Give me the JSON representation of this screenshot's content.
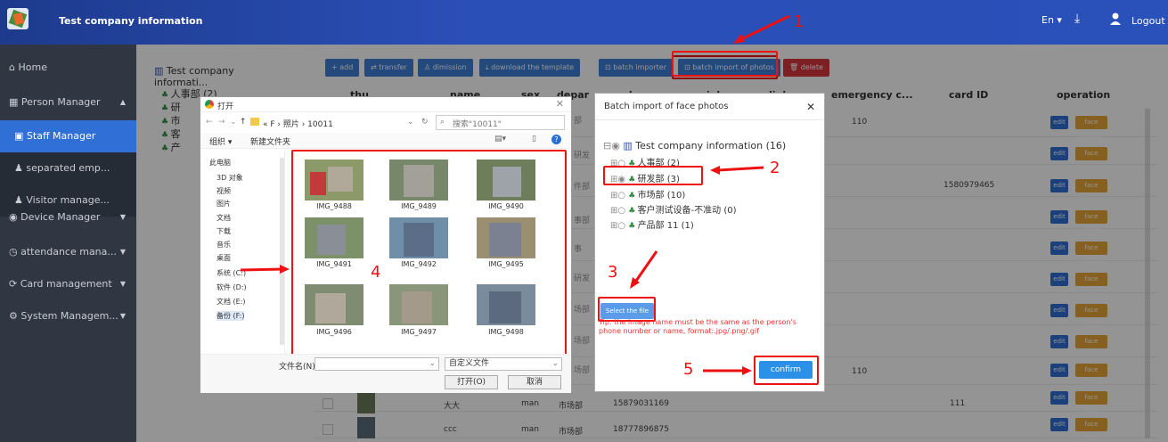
{
  "header": {
    "title": "Test company information",
    "lang": "En ▾",
    "download_icon": "download-icon",
    "logout": "Logout"
  },
  "sidebar": {
    "items": [
      {
        "label": "Home",
        "icon": "⌂"
      },
      {
        "label": "Person Manager",
        "icon": "▦"
      },
      {
        "label": "Staff Manager",
        "icon": "▣"
      },
      {
        "label": "separated emp...",
        "icon": "♟"
      },
      {
        "label": "Visitor manage...",
        "icon": "♟"
      },
      {
        "label": "Device Manager",
        "icon": "◉"
      },
      {
        "label": "attendance mana...",
        "icon": "◷"
      },
      {
        "label": "Card management",
        "icon": "⟳"
      },
      {
        "label": "System Managem...",
        "icon": "⚙"
      }
    ]
  },
  "tree": {
    "root": "Test company informati...",
    "nodes": [
      "人事部 (2)",
      "研",
      "市",
      "客",
      "产"
    ]
  },
  "toolbar": {
    "add": "+ add",
    "transfer": "⇄ transfer",
    "dimission": "♙ dimission",
    "download": "⤓ download the template",
    "batch_importer": "⊡ batch importer",
    "batch_photos": "⊡ batch import of photos",
    "delete": "🗑 delete"
  },
  "table": {
    "headers": [
      "thu",
      "name",
      "sex",
      "depar",
      "phone",
      "job",
      "linkman",
      "emergency c...",
      "card ID",
      "operation"
    ],
    "row1_emergency": "110",
    "row3_card": "1580979465",
    "row10_emergency": "110",
    "row11": {
      "name": "大大",
      "sex": "man",
      "dept": "市场部",
      "phone": "15879031169",
      "card": "111"
    },
    "row12": {
      "name": "ccc",
      "sex": "man",
      "dept": "市场部",
      "phone": "18777896875"
    },
    "edit": "edit",
    "face": "face figure",
    "partial_depts": [
      "部",
      "研发",
      "件部",
      "事部",
      "事",
      "研发",
      "场部",
      "场部",
      "场部",
      "场部"
    ]
  },
  "file_dialog": {
    "title": "打开",
    "path": "« F › 照片 › 10011",
    "search_placeholder": "搜索\"10011\"",
    "organize": "组织 ▾",
    "new_folder": "新建文件夹",
    "left_items": [
      "此电脑",
      "3D 对象",
      "视频",
      "图片",
      "文档",
      "下载",
      "音乐",
      "桌面",
      "系统 (C:)",
      "软件 (D:)",
      "文档 (E:)",
      "备份 (F:)"
    ],
    "files": [
      "IMG_9488",
      "IMG_9489",
      "IMG_9490",
      "IMG_9491",
      "IMG_9492",
      "IMG_9495",
      "IMG_9496",
      "IMG_9497",
      "IMG_9498"
    ],
    "filename_label": "文件名(N):",
    "filter": "自定义文件",
    "open": "打开(O)",
    "cancel": "取消"
  },
  "batch_dialog": {
    "title": "Batch import of face photos",
    "close": "✕",
    "root": "Test company information (16)",
    "nodes": [
      "人事部 (2)",
      "研发部 (3)",
      "市场部 (10)",
      "客户测试设备-不准动 (0)",
      "产品部 11 (1)"
    ],
    "select_file": "Select the file",
    "tip": "Tip: the image name must be the same as the person's phone number or name, format:.jpg/.png/.gif",
    "confirm": "confirm"
  },
  "annotations": [
    "1",
    "2",
    "3",
    "4",
    "5"
  ],
  "colors": {
    "accent": "#2f6fd6",
    "warn": "#e6a53a",
    "danger": "#e11111",
    "header": "#2a4fb7",
    "sidebar": "#303742"
  }
}
